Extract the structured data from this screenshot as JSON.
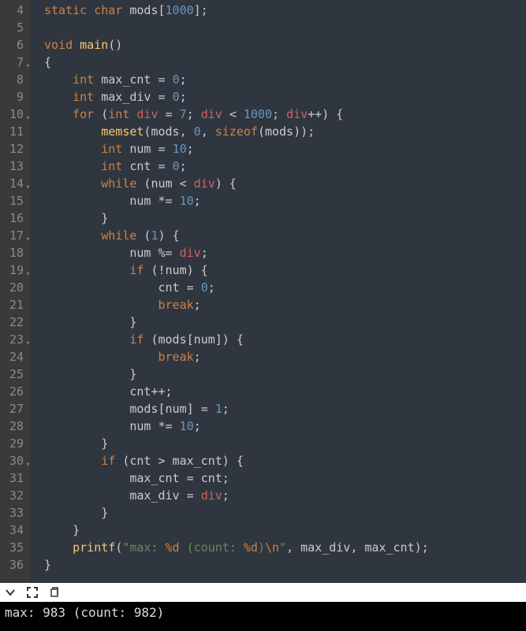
{
  "lines": [
    {
      "n": 4,
      "fold": false,
      "tokens": [
        [
          "kw",
          "static"
        ],
        [
          "id",
          " "
        ],
        [
          "ty",
          "char"
        ],
        [
          "id",
          " mods["
        ],
        [
          "nm",
          "1000"
        ],
        [
          "id",
          "];"
        ]
      ]
    },
    {
      "n": 5,
      "fold": false,
      "tokens": []
    },
    {
      "n": 6,
      "fold": false,
      "tokens": [
        [
          "ty",
          "void"
        ],
        [
          "id",
          " "
        ],
        [
          "fn",
          "main"
        ],
        [
          "id",
          "()"
        ]
      ]
    },
    {
      "n": 7,
      "fold": true,
      "tokens": [
        [
          "id",
          "{"
        ]
      ]
    },
    {
      "n": 8,
      "fold": false,
      "tokens": [
        [
          "id",
          "    "
        ],
        [
          "ty",
          "int"
        ],
        [
          "id",
          " max_cnt "
        ],
        [
          "op",
          "="
        ],
        [
          "id",
          " "
        ],
        [
          "nm",
          "0"
        ],
        [
          "id",
          ";"
        ]
      ]
    },
    {
      "n": 9,
      "fold": false,
      "tokens": [
        [
          "id",
          "    "
        ],
        [
          "ty",
          "int"
        ],
        [
          "id",
          " max_div "
        ],
        [
          "op",
          "="
        ],
        [
          "id",
          " "
        ],
        [
          "nm",
          "0"
        ],
        [
          "id",
          ";"
        ]
      ]
    },
    {
      "n": 10,
      "fold": true,
      "tokens": [
        [
          "id",
          "    "
        ],
        [
          "kw",
          "for"
        ],
        [
          "id",
          " ("
        ],
        [
          "ty",
          "int"
        ],
        [
          "id",
          " "
        ],
        [
          "va",
          "div"
        ],
        [
          "id",
          " "
        ],
        [
          "op",
          "="
        ],
        [
          "id",
          " "
        ],
        [
          "nm",
          "7"
        ],
        [
          "id",
          "; "
        ],
        [
          "va",
          "div"
        ],
        [
          "id",
          " "
        ],
        [
          "op",
          "<"
        ],
        [
          "id",
          " "
        ],
        [
          "nm",
          "1000"
        ],
        [
          "id",
          "; "
        ],
        [
          "va",
          "div"
        ],
        [
          "op",
          "++"
        ],
        [
          "id",
          ") {"
        ]
      ]
    },
    {
      "n": 11,
      "fold": false,
      "tokens": [
        [
          "id",
          "        "
        ],
        [
          "fn",
          "memset"
        ],
        [
          "id",
          "(mods, "
        ],
        [
          "nm",
          "0"
        ],
        [
          "id",
          ", "
        ],
        [
          "kw",
          "sizeof"
        ],
        [
          "id",
          "(mods));"
        ]
      ]
    },
    {
      "n": 12,
      "fold": false,
      "tokens": [
        [
          "id",
          "        "
        ],
        [
          "ty",
          "int"
        ],
        [
          "id",
          " num "
        ],
        [
          "op",
          "="
        ],
        [
          "id",
          " "
        ],
        [
          "nm",
          "10"
        ],
        [
          "id",
          ";"
        ]
      ]
    },
    {
      "n": 13,
      "fold": false,
      "tokens": [
        [
          "id",
          "        "
        ],
        [
          "ty",
          "int"
        ],
        [
          "id",
          " cnt "
        ],
        [
          "op",
          "="
        ],
        [
          "id",
          " "
        ],
        [
          "nm",
          "0"
        ],
        [
          "id",
          ";"
        ]
      ]
    },
    {
      "n": 14,
      "fold": true,
      "tokens": [
        [
          "id",
          "        "
        ],
        [
          "kw",
          "while"
        ],
        [
          "id",
          " (num "
        ],
        [
          "op",
          "<"
        ],
        [
          "id",
          " "
        ],
        [
          "va",
          "div"
        ],
        [
          "id",
          ") {"
        ]
      ]
    },
    {
      "n": 15,
      "fold": false,
      "tokens": [
        [
          "id",
          "            num "
        ],
        [
          "op",
          "*="
        ],
        [
          "id",
          " "
        ],
        [
          "nm",
          "10"
        ],
        [
          "id",
          ";"
        ]
      ]
    },
    {
      "n": 16,
      "fold": false,
      "tokens": [
        [
          "id",
          "        }"
        ]
      ]
    },
    {
      "n": 17,
      "fold": true,
      "tokens": [
        [
          "id",
          "        "
        ],
        [
          "kw",
          "while"
        ],
        [
          "id",
          " ("
        ],
        [
          "nm",
          "1"
        ],
        [
          "id",
          ") {"
        ]
      ]
    },
    {
      "n": 18,
      "fold": false,
      "tokens": [
        [
          "id",
          "            num "
        ],
        [
          "op",
          "%="
        ],
        [
          "id",
          " "
        ],
        [
          "va",
          "div"
        ],
        [
          "id",
          ";"
        ]
      ]
    },
    {
      "n": 19,
      "fold": true,
      "tokens": [
        [
          "id",
          "            "
        ],
        [
          "kw",
          "if"
        ],
        [
          "id",
          " ("
        ],
        [
          "op",
          "!"
        ],
        [
          "id",
          "num) {"
        ]
      ]
    },
    {
      "n": 20,
      "fold": false,
      "tokens": [
        [
          "id",
          "                cnt "
        ],
        [
          "op",
          "="
        ],
        [
          "id",
          " "
        ],
        [
          "nm",
          "0"
        ],
        [
          "id",
          ";"
        ]
      ]
    },
    {
      "n": 21,
      "fold": false,
      "tokens": [
        [
          "id",
          "                "
        ],
        [
          "kw",
          "break"
        ],
        [
          "id",
          ";"
        ]
      ]
    },
    {
      "n": 22,
      "fold": false,
      "tokens": [
        [
          "id",
          "            }"
        ]
      ]
    },
    {
      "n": 23,
      "fold": true,
      "tokens": [
        [
          "id",
          "            "
        ],
        [
          "kw",
          "if"
        ],
        [
          "id",
          " (mods[num]) {"
        ]
      ]
    },
    {
      "n": 24,
      "fold": false,
      "tokens": [
        [
          "id",
          "                "
        ],
        [
          "kw",
          "break"
        ],
        [
          "id",
          ";"
        ]
      ]
    },
    {
      "n": 25,
      "fold": false,
      "tokens": [
        [
          "id",
          "            }"
        ]
      ]
    },
    {
      "n": 26,
      "fold": false,
      "tokens": [
        [
          "id",
          "            cnt"
        ],
        [
          "op",
          "++"
        ],
        [
          "id",
          ";"
        ]
      ]
    },
    {
      "n": 27,
      "fold": false,
      "tokens": [
        [
          "id",
          "            mods[num] "
        ],
        [
          "op",
          "="
        ],
        [
          "id",
          " "
        ],
        [
          "nm",
          "1"
        ],
        [
          "id",
          ";"
        ]
      ]
    },
    {
      "n": 28,
      "fold": false,
      "tokens": [
        [
          "id",
          "            num "
        ],
        [
          "op",
          "*="
        ],
        [
          "id",
          " "
        ],
        [
          "nm",
          "10"
        ],
        [
          "id",
          ";"
        ]
      ]
    },
    {
      "n": 29,
      "fold": false,
      "tokens": [
        [
          "id",
          "        }"
        ]
      ]
    },
    {
      "n": 30,
      "fold": true,
      "tokens": [
        [
          "id",
          "        "
        ],
        [
          "kw",
          "if"
        ],
        [
          "id",
          " (cnt "
        ],
        [
          "op",
          ">"
        ],
        [
          "id",
          " max_cnt) {"
        ]
      ]
    },
    {
      "n": 31,
      "fold": false,
      "tokens": [
        [
          "id",
          "            max_cnt "
        ],
        [
          "op",
          "="
        ],
        [
          "id",
          " cnt;"
        ]
      ]
    },
    {
      "n": 32,
      "fold": false,
      "tokens": [
        [
          "id",
          "            max_div "
        ],
        [
          "op",
          "="
        ],
        [
          "id",
          " "
        ],
        [
          "va",
          "div"
        ],
        [
          "id",
          ";"
        ]
      ]
    },
    {
      "n": 33,
      "fold": false,
      "tokens": [
        [
          "id",
          "        }"
        ]
      ]
    },
    {
      "n": 34,
      "fold": false,
      "tokens": [
        [
          "id",
          "    }"
        ]
      ]
    },
    {
      "n": 35,
      "fold": false,
      "tokens": [
        [
          "id",
          "    "
        ],
        [
          "fn",
          "printf"
        ],
        [
          "id",
          "("
        ],
        [
          "st",
          "\"max: "
        ],
        [
          "es",
          "%d"
        ],
        [
          "st",
          " (count: "
        ],
        [
          "es",
          "%d"
        ],
        [
          "st",
          ")"
        ],
        [
          "es",
          "\\n"
        ],
        [
          "st",
          "\""
        ],
        [
          "id",
          ", max_div, max_cnt);"
        ]
      ]
    },
    {
      "n": 36,
      "fold": false,
      "tokens": [
        [
          "id",
          "}"
        ]
      ]
    }
  ],
  "console_output": "max: 983 (count: 982)"
}
